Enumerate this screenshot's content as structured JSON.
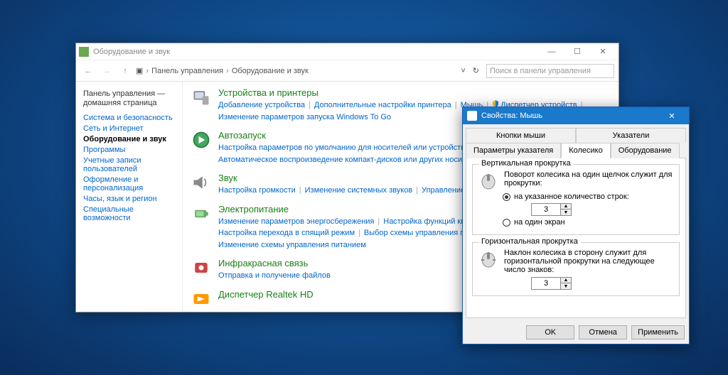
{
  "cp": {
    "title": "Оборудование и звук",
    "min": "—",
    "max": "☐",
    "close": "✕",
    "breadcrumb": {
      "root": "Панель управления",
      "leaf": "Оборудование и звук"
    },
    "search_placeholder": "Поиск в панели управления",
    "chevdown": "˅",
    "refresh": "↻",
    "sidebar": {
      "head": "Панель управления — домашняя страница",
      "items": [
        "Система и безопасность",
        "Сеть и Интернет",
        "Оборудование и звук",
        "Программы",
        "Учетные записи пользователей",
        "Оформление и персонализация",
        "Часы, язык и регион",
        "Специальные возможности"
      ],
      "selected_index": 2
    },
    "categories": [
      {
        "title": "Устройства и принтеры",
        "links": [
          "Добавление устройства",
          "Дополнительные настройки принтера",
          "Мышь",
          "Диспетчер устройств",
          "Изменение параметров запуска Windows To Go"
        ],
        "shields": [
          false,
          false,
          false,
          true,
          false
        ]
      },
      {
        "title": "Автозапуск",
        "links": [
          "Настройка параметров по умолчанию для носителей или устройств",
          "Автоматическое воспроизведение компакт-дисков или других носителей"
        ]
      },
      {
        "title": "Звук",
        "links": [
          "Настройка громкости",
          "Изменение системных звуков",
          "Управление звуковыми устройствами"
        ]
      },
      {
        "title": "Электропитание",
        "links": [
          "Изменение параметров энергосбережения",
          "Настройка функций кнопок питания",
          "Настройка перехода в спящий режим",
          "Выбор схемы управления питанием",
          "Изменение схемы управления питанием"
        ]
      },
      {
        "title": "Инфракрасная связь",
        "links": [
          "Отправка и получение файлов"
        ]
      },
      {
        "title": "Диспетчер Realtek HD",
        "links": []
      }
    ]
  },
  "mouse": {
    "title": "Свойства: Мышь",
    "close": "✕",
    "tabs_row1": [
      "Кнопки мыши",
      "Указатели"
    ],
    "tabs_row2": [
      "Параметры указателя",
      "Колесико",
      "Оборудование"
    ],
    "active_tab": "Колесико",
    "vgroup": {
      "title": "Вертикальная прокрутка",
      "desc": "Поворот колесика на один щелчок служит для прокрутки:",
      "radio1": "на указанное количество строк:",
      "value": "3",
      "radio2": "на один экран"
    },
    "hgroup": {
      "title": "Горизонтальная прокрутка",
      "desc": "Наклон колесика в сторону служит для горизонтальной прокрутки на следующее число знаков:",
      "value": "3"
    },
    "buttons": {
      "ok": "OK",
      "cancel": "Отмена",
      "apply": "Применить"
    }
  }
}
